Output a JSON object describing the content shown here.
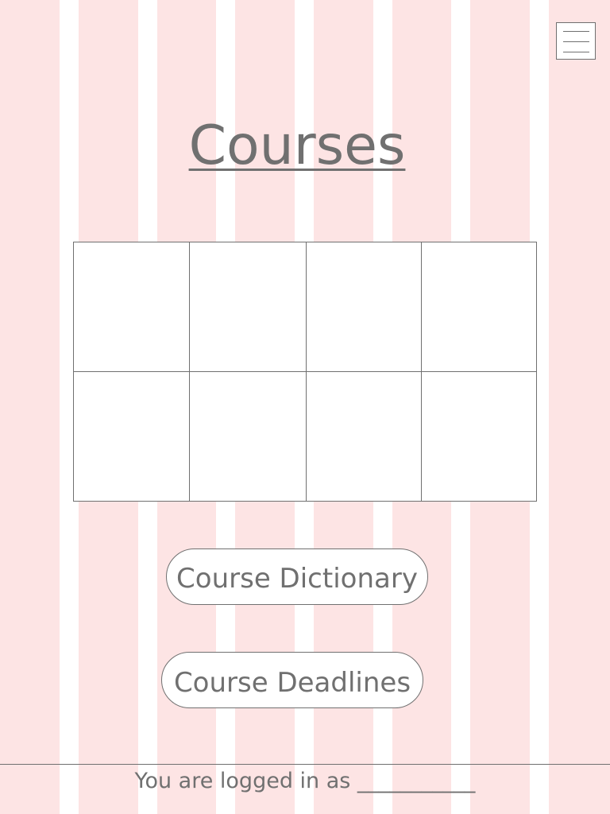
{
  "page": {
    "title": "Courses"
  },
  "menu": {
    "icon": "hamburger-menu-icon"
  },
  "course_grid": {
    "rows": 2,
    "columns": 4,
    "cells": [
      "",
      "",
      "",
      "",
      "",
      "",
      "",
      ""
    ]
  },
  "buttons": {
    "course_dictionary": "Course Dictionary",
    "course_deadlines": "Course Deadlines"
  },
  "footer": {
    "login_status": "You are logged in as ___________"
  },
  "colors": {
    "text": "#707070",
    "border": "#707070",
    "stripe_pink": "#fde4e4",
    "surface": "#ffffff"
  }
}
